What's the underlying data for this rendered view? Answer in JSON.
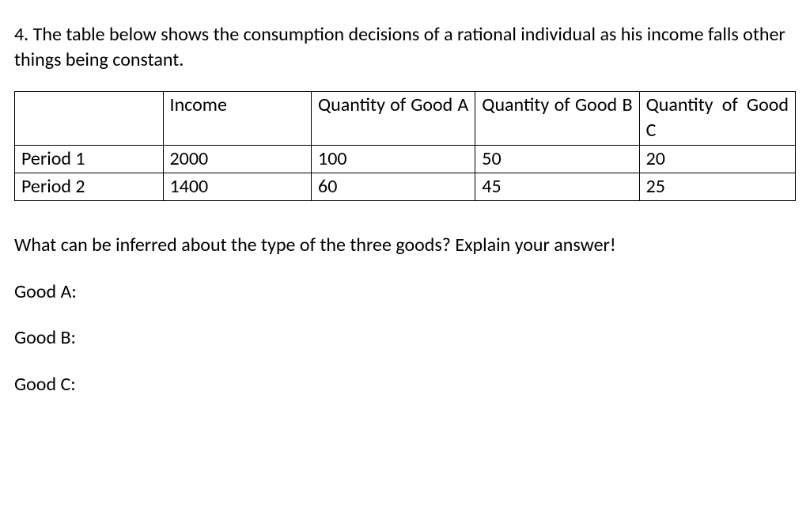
{
  "intro": "4. The table below shows the consumption decisions of a rational individual as his income falls other things being constant.",
  "table": {
    "headers": {
      "col0": "",
      "col1": "Income",
      "col2": "Quantity of Good A",
      "col3": "Quantity of Good B",
      "col4": "Quantity of Good C"
    },
    "rows": [
      {
        "label": "Period 1",
        "income": "2000",
        "goodA": "100",
        "goodB": "50",
        "goodC": "20"
      },
      {
        "label": "Period 2",
        "income": "1400",
        "goodA": "60",
        "goodB": "45",
        "goodC": "25"
      }
    ]
  },
  "question": "What can be inferred about the type of the three goods? Explain your answer!",
  "answerA": "Good A:",
  "answerB": "Good B:",
  "answerC": "Good C:",
  "chart_data": {
    "type": "table",
    "title": "Consumption decisions of a rational individual as income falls",
    "series": [
      {
        "name": "Income",
        "values": [
          2000,
          1400
        ]
      },
      {
        "name": "Quantity of Good A",
        "values": [
          100,
          60
        ]
      },
      {
        "name": "Quantity of Good B",
        "values": [
          50,
          45
        ]
      },
      {
        "name": "Quantity of Good C",
        "values": [
          20,
          25
        ]
      }
    ],
    "categories": [
      "Period 1",
      "Period 2"
    ]
  }
}
